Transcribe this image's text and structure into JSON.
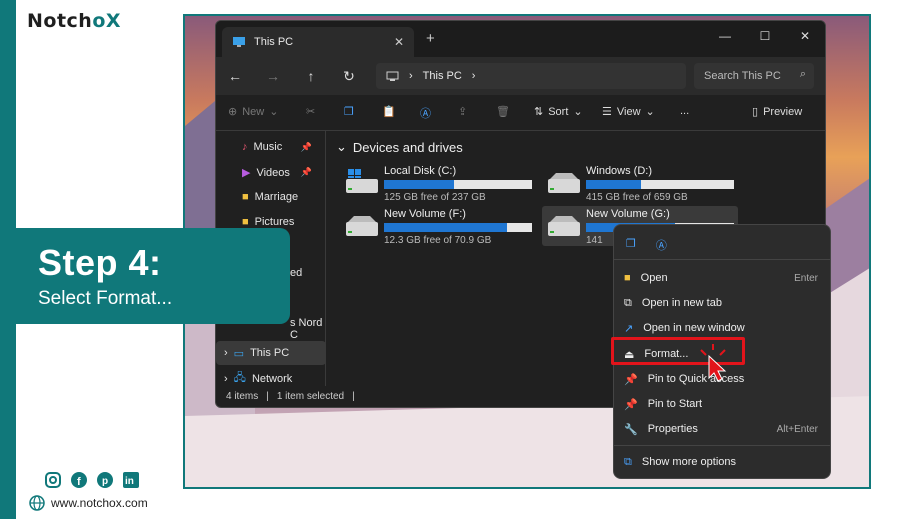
{
  "brand": {
    "logo_prefix": "Notch",
    "logo_o": "o",
    "logo_suffix": "X",
    "website": "www.notchox.com"
  },
  "step": {
    "title": "Step 4:",
    "subtitle": "Select Format..."
  },
  "social": {
    "icons": [
      "instagram-icon",
      "facebook-icon",
      "pinterest-icon",
      "linkedin-icon"
    ]
  },
  "window": {
    "tab_title": "This PC",
    "address": "This PC",
    "search_placeholder": "Search This PC",
    "toolbar": {
      "new": "New",
      "sort": "Sort",
      "view": "View",
      "more": "...",
      "preview": "Preview"
    },
    "sidebar": [
      {
        "label": "Music",
        "pinned": true
      },
      {
        "label": "Videos",
        "pinned": true
      },
      {
        "label": "Marriage",
        "pinned": false
      },
      {
        "label": "Pictures",
        "pinned": false
      },
      {
        "label": "ed"
      },
      {
        "label": "s Nord C"
      },
      {
        "label": "This PC",
        "selected": true
      },
      {
        "label": "Network"
      }
    ],
    "section_header": "Devices and drives",
    "drives": [
      {
        "name": "Local Disk (C:)",
        "free": "125 GB free of 237 GB",
        "used_fraction": 0.47
      },
      {
        "name": "Windows (D:)",
        "free": "415 GB free of 659 GB",
        "used_fraction": 0.37
      },
      {
        "name": "New Volume (F:)",
        "free": "12.3 GB free of 70.9 GB",
        "used_fraction": 0.83
      },
      {
        "name": "New Volume (G:)",
        "free": "141",
        "used_fraction": 0.6
      }
    ],
    "status": {
      "items": "4 items",
      "selected": "1 item selected"
    }
  },
  "context_menu": {
    "items": [
      {
        "label": "Open",
        "shortcut": "Enter"
      },
      {
        "label": "Open in new tab",
        "shortcut": ""
      },
      {
        "label": "Open in new window",
        "shortcut": ""
      },
      {
        "label": "Format...",
        "shortcut": ""
      },
      {
        "label": "Pin to Quick access",
        "shortcut": ""
      },
      {
        "label": "Pin to Start",
        "shortcut": ""
      },
      {
        "label": "Properties",
        "shortcut": "Alt+Enter"
      },
      {
        "label": "Show more options",
        "shortcut": ""
      }
    ]
  },
  "colors": {
    "brand": "#10787a",
    "highlight": "#e2141b",
    "drive_fill": "#1f76d2"
  }
}
